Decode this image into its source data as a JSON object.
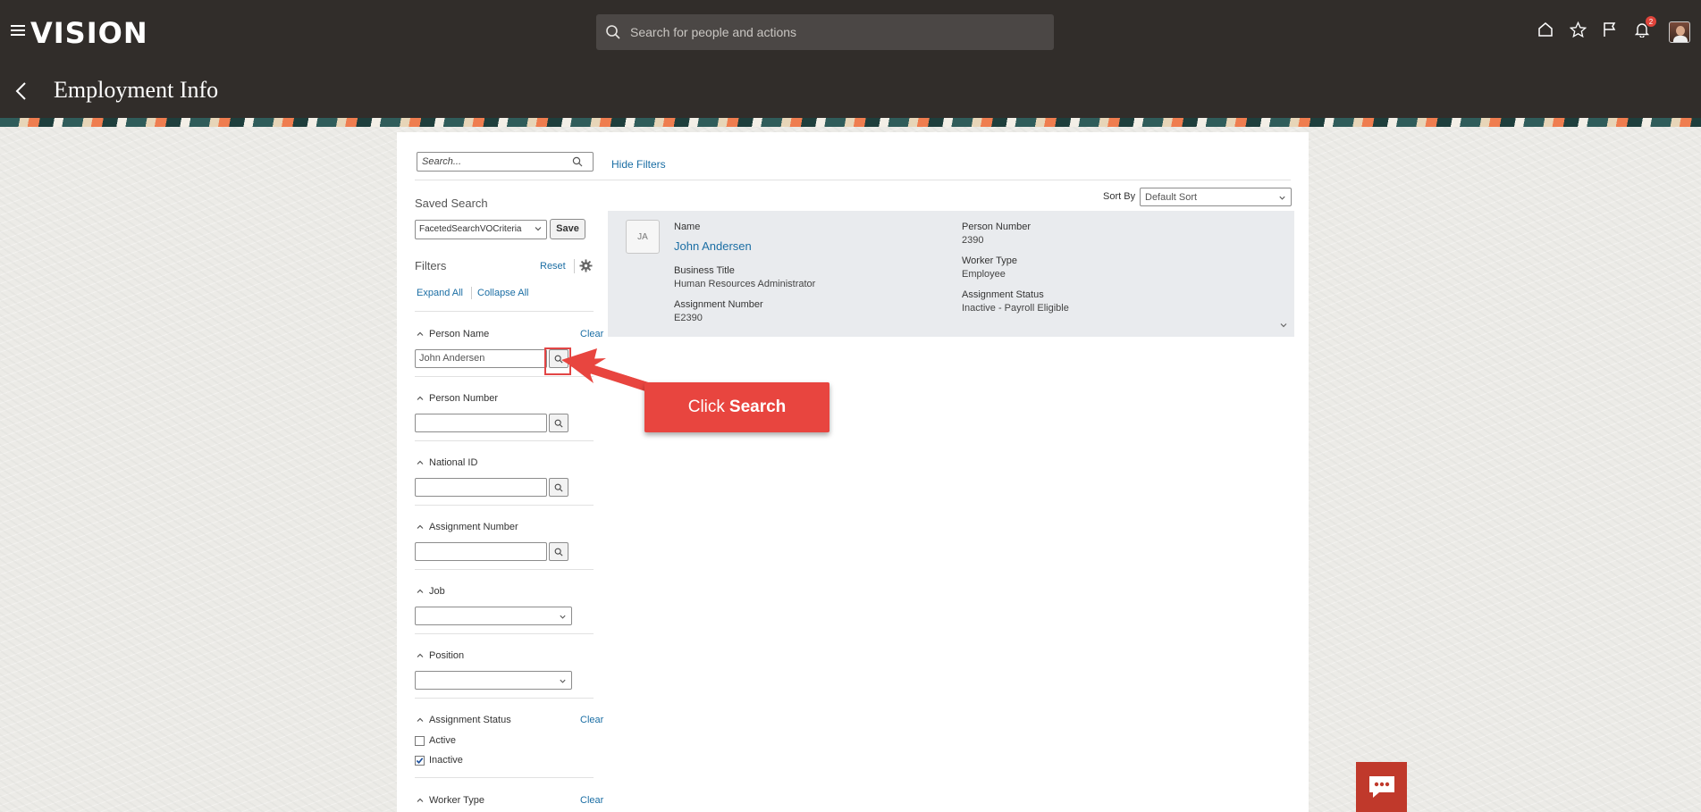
{
  "header": {
    "logo": "VISION",
    "search_placeholder": "Search for people and actions",
    "notification_count": "2",
    "page_title": "Employment Info"
  },
  "panel": {
    "search_placeholder": "Search...",
    "hide_filters": "Hide Filters",
    "sort_by_label": "Sort By",
    "sort_by_value": "Default Sort"
  },
  "filters": {
    "saved_search_label": "Saved Search",
    "saved_search_value": "FacetedSearchVOCriteria",
    "save_button": "Save",
    "filters_label": "Filters",
    "reset": "Reset",
    "expand_all": "Expand All",
    "collapse_all": "Collapse All",
    "clear": "Clear",
    "person_name": {
      "label": "Person Name",
      "value": "John Andersen"
    },
    "person_number": {
      "label": "Person Number"
    },
    "national_id": {
      "label": "National ID"
    },
    "assignment_number": {
      "label": "Assignment Number"
    },
    "job": {
      "label": "Job"
    },
    "position": {
      "label": "Position"
    },
    "assignment_status": {
      "label": "Assignment Status",
      "options": [
        {
          "label": "Active",
          "checked": false
        },
        {
          "label": "Inactive",
          "checked": true
        }
      ]
    },
    "worker_type": {
      "label": "Worker Type"
    }
  },
  "result": {
    "initials": "JA",
    "name_label": "Name",
    "name": "John Andersen",
    "business_title_label": "Business Title",
    "business_title": "Human Resources Administrator",
    "assignment_number_label": "Assignment Number",
    "assignment_number": "E2390",
    "person_number_label": "Person Number",
    "person_number": "2390",
    "worker_type_label": "Worker Type",
    "worker_type": "Employee",
    "assignment_status_label": "Assignment Status",
    "assignment_status": "Inactive - Payroll Eligible"
  },
  "callout": {
    "prefix": "Click",
    "action": "Search"
  },
  "colors": {
    "header_bg": "#312d2a",
    "link": "#1b6ea4",
    "callout": "#e8453f",
    "card_bg": "#e9ebee"
  }
}
